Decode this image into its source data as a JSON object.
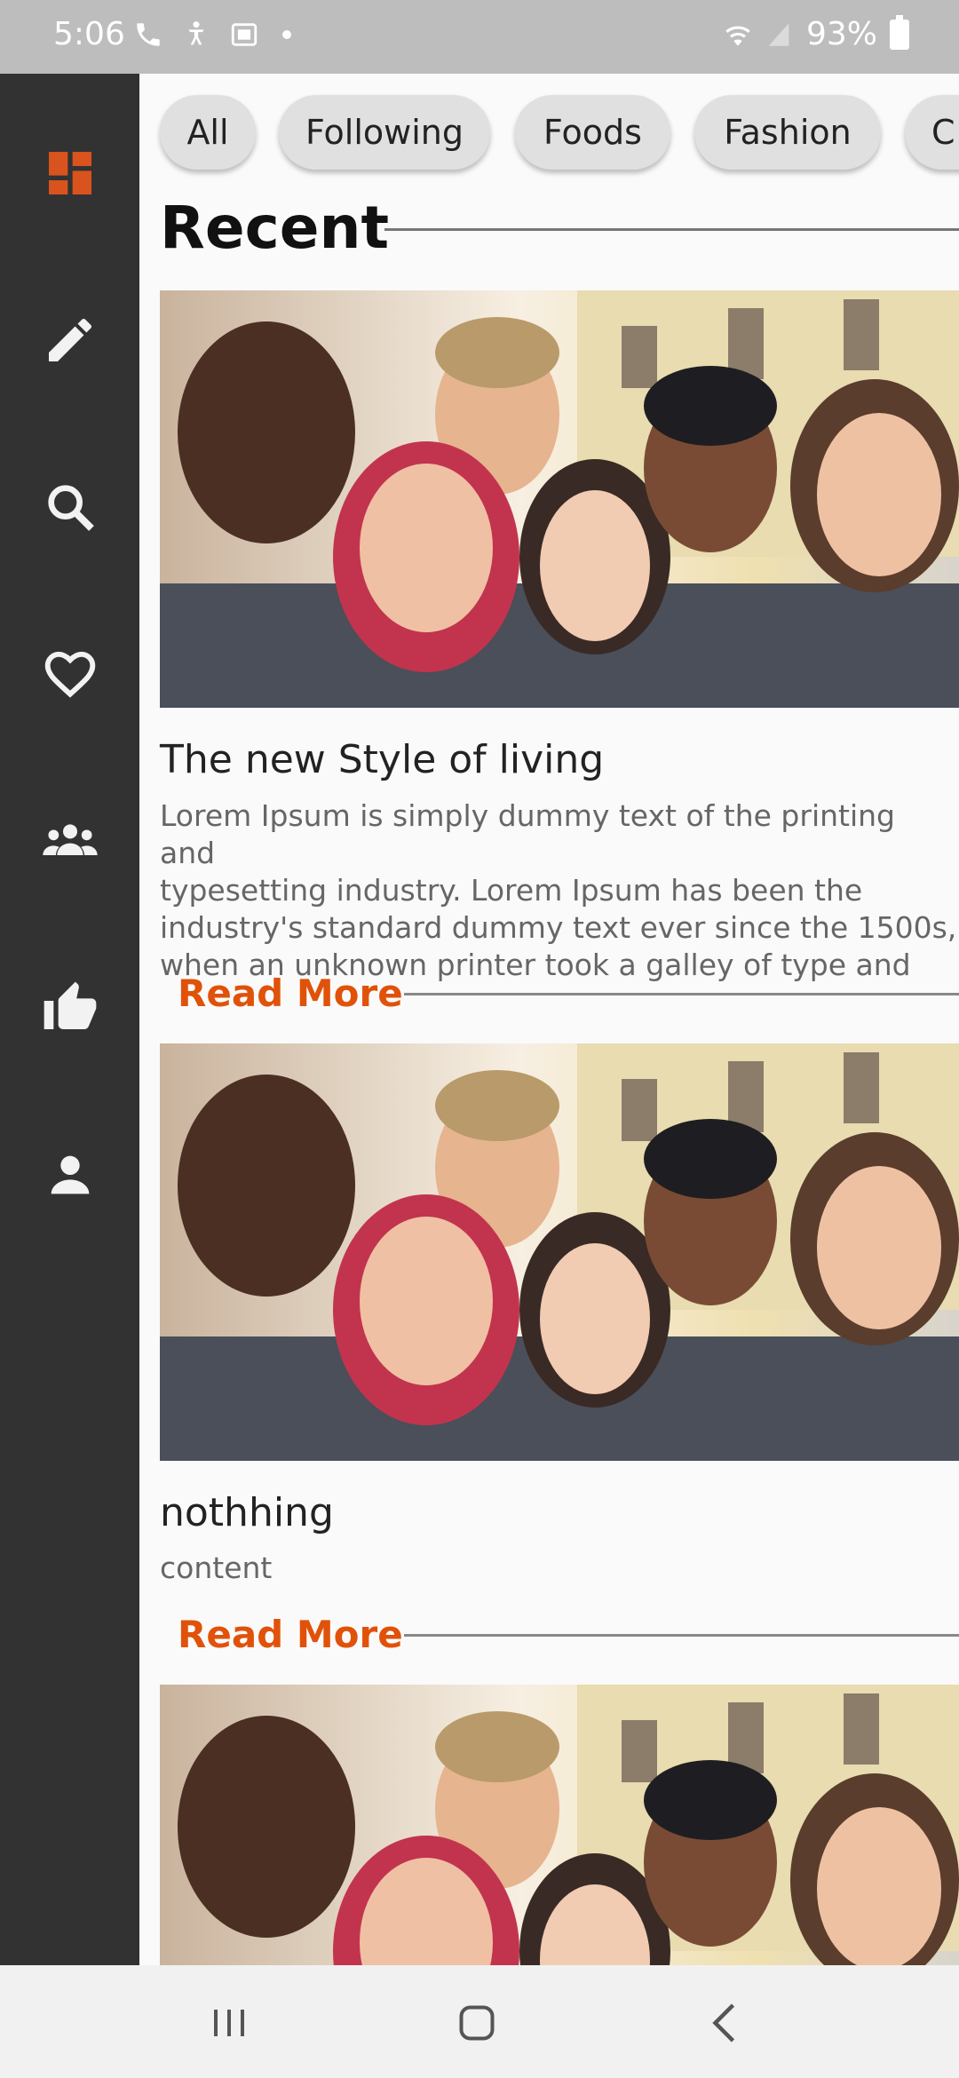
{
  "status_bar": {
    "time": "5:06",
    "battery": "93%",
    "icons": [
      "phone-icon",
      "accessibility-icon",
      "cast-icon",
      "dot",
      "wifi-icon",
      "signal-icon",
      "battery-icon"
    ]
  },
  "sidebar": {
    "items": [
      {
        "icon": "dashboard-icon",
        "active": true
      },
      {
        "icon": "edit-icon",
        "active": false
      },
      {
        "icon": "search-icon",
        "active": false
      },
      {
        "icon": "heart-icon",
        "active": false
      },
      {
        "icon": "group-icon",
        "active": false
      },
      {
        "icon": "thumb-up-icon",
        "active": false
      },
      {
        "icon": "person-icon",
        "active": false
      }
    ],
    "active_color": "#d9531e",
    "icon_color": "#f2f2f2"
  },
  "chips": [
    "All",
    "Following",
    "Foods",
    "Fashion",
    "C"
  ],
  "section": {
    "title": "Recent"
  },
  "posts": [
    {
      "title": "The new Style of living",
      "body_lines": [
        "Lorem Ipsum is simply dummy text of the printing and",
        "typesetting industry. Lorem Ipsum has been the",
        "industry's standard dummy text ever since the 1500s,",
        "when an unknown printer took a galley of type and"
      ],
      "read_more": "Read More"
    },
    {
      "title": "nothhing",
      "body_lines": [
        "content"
      ],
      "read_more": "Read More"
    }
  ],
  "colors": {
    "accent": "#e0520a",
    "sidebar_bg": "#323232"
  }
}
